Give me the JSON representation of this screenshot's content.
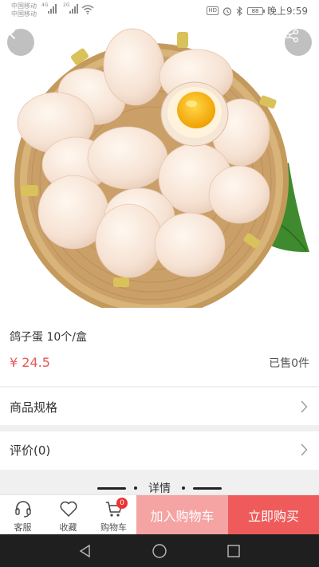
{
  "status_bar": {
    "carrier_1": "中国移动",
    "carrier_2": "中国移动",
    "signal_1_label": "4G",
    "signal_2_label": "2G",
    "hd": "HD",
    "battery": "88",
    "time": "晚上9:59",
    "icons": [
      "wifi-icon",
      "alarm-icon",
      "bluetooth-icon",
      "battery-icon"
    ]
  },
  "product": {
    "name": "鸽子蛋 10个/盒",
    "price": "¥ 24.5",
    "sold": "已售0件",
    "image_subject": "basket-of-pigeon-eggs"
  },
  "sections": {
    "specs_label": "商品规格",
    "reviews_label": "评价(0)",
    "details_title": "详情"
  },
  "bottom_bar": {
    "service_label": "客服",
    "favorite_label": "收藏",
    "cart_label": "购物车",
    "cart_count": "0",
    "add_to_cart": "加入购物车",
    "buy_now": "立即购买"
  },
  "colors": {
    "price": "#e35a5a",
    "add_to_cart_bg": "#f5a3a3",
    "buy_now_bg": "#ef5b5b",
    "badge": "#ee3333"
  }
}
